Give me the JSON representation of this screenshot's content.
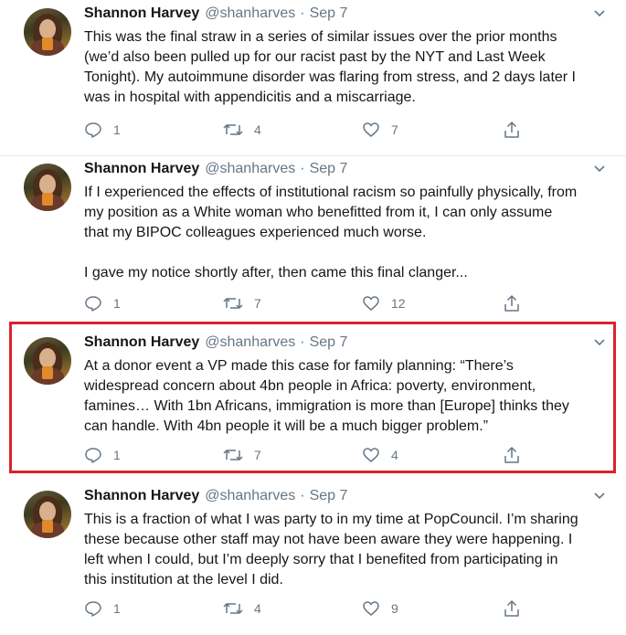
{
  "colors": {
    "highlight_border": "#d9232e",
    "secondary_text": "#657786",
    "primary_text": "#14171a"
  },
  "tweets": [
    {
      "name": "Shannon Harvey",
      "handle": "@shanharves",
      "separator": "·",
      "date": "Sep 7",
      "text": "This was the final straw in a series of similar issues over the prior months\n(we’d also been pulled up for our racist past by the NYT and Last Week\nTonight). My autoimmune disorder was flaring from stress, and 2 days later I\nwas in hospital with appendicitis and a miscarriage.",
      "replies": "1",
      "retweets": "4",
      "likes": "7"
    },
    {
      "name": "Shannon Harvey",
      "handle": "@shanharves",
      "separator": "·",
      "date": "Sep 7",
      "text": "If I experienced the effects of institutional racism so painfully physically, from\nmy position as a White woman who benefitted from it, I can only assume\nthat my BIPOC colleagues experienced much worse.\n\nI gave my notice shortly after, then came this final clanger...",
      "replies": "1",
      "retweets": "7",
      "likes": "12"
    },
    {
      "name": "Shannon Harvey",
      "handle": "@shanharves",
      "separator": "·",
      "date": "Sep 7",
      "text": "At a donor event a VP made this case for family planning: “There’s\nwidespread concern about 4bn people in Africa: poverty, environment,\nfamines… With 1bn Africans, immigration is more than [Europe] thinks they\ncan handle. With 4bn people it will be a much bigger problem.”",
      "replies": "1",
      "retweets": "7",
      "likes": "4"
    },
    {
      "name": "Shannon Harvey",
      "handle": "@shanharves",
      "separator": "·",
      "date": "Sep 7",
      "text": "This is a fraction of what I was party to in my time at PopCouncil. I’m sharing\nthese because other staff may not have been aware they were happening. I\nleft when I could, but I’m deeply sorry that I benefited from participating in\nthis institution at the level I did.",
      "replies": "1",
      "retweets": "4",
      "likes": "9"
    }
  ]
}
